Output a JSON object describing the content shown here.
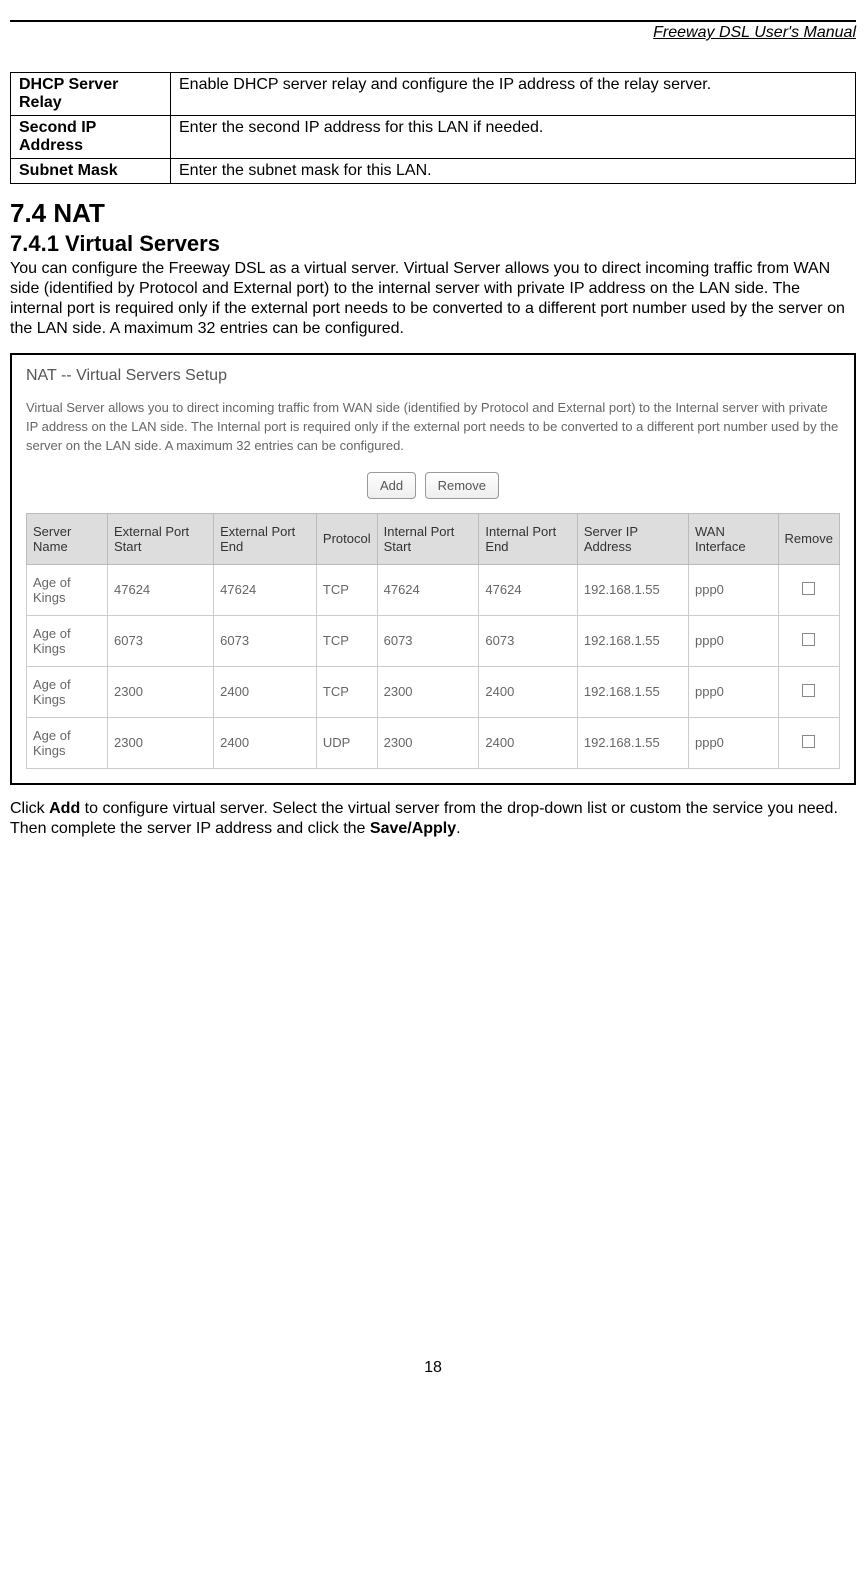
{
  "header": {
    "manual_title": "Freeway DSL User's Manual"
  },
  "def_table": [
    {
      "label": "DHCP Server Relay",
      "desc": "Enable DHCP server relay and configure the IP address of the relay server."
    },
    {
      "label": "Second IP Address",
      "desc": "Enter the second IP address for this LAN if needed."
    },
    {
      "label": "Subnet Mask",
      "desc": "Enter the subnet mask for this LAN."
    }
  ],
  "section": {
    "num_title": "7.4   NAT",
    "sub_num_title": "7.4.1    Virtual Servers",
    "intro": "You can configure the Freeway DSL as a virtual server. Virtual Server allows you to direct incoming traffic from WAN side (identified by Protocol and External port) to the internal server with private IP address on the LAN side. The internal port is required only if the external port needs to be converted to a different port number used by the server on the LAN side. A maximum 32 entries can be configured."
  },
  "screenshot": {
    "title": "NAT -- Virtual Servers Setup",
    "para": "Virtual Server allows you to direct incoming traffic from WAN side (identified by Protocol and External port) to the Internal server with private IP address on the LAN side. The Internal port is required only if the external port needs to be converted to a different port number used by the server on the LAN side. A maximum 32 entries can be configured.",
    "buttons": {
      "add": "Add",
      "remove": "Remove"
    },
    "headers": [
      "Server Name",
      "External Port Start",
      "External Port End",
      "Protocol",
      "Internal Port Start",
      "Internal Port End",
      "Server IP Address",
      "WAN Interface",
      "Remove"
    ],
    "rows": [
      {
        "name": "Age of Kings",
        "eps": "47624",
        "epe": "47624",
        "proto": "TCP",
        "ips": "47624",
        "ipe": "47624",
        "ip": "192.168.1.55",
        "wan": "ppp0"
      },
      {
        "name": "Age of Kings",
        "eps": "6073",
        "epe": "6073",
        "proto": "TCP",
        "ips": "6073",
        "ipe": "6073",
        "ip": "192.168.1.55",
        "wan": "ppp0"
      },
      {
        "name": "Age of Kings",
        "eps": "2300",
        "epe": "2400",
        "proto": "TCP",
        "ips": "2300",
        "ipe": "2400",
        "ip": "192.168.1.55",
        "wan": "ppp0"
      },
      {
        "name": "Age of Kings",
        "eps": "2300",
        "epe": "2400",
        "proto": "UDP",
        "ips": "2300",
        "ipe": "2400",
        "ip": "192.168.1.55",
        "wan": "ppp0"
      }
    ]
  },
  "after": {
    "pre1": "Click ",
    "bold1": "Add",
    "mid1": " to configure virtual server. Select the virtual server from the drop-down list or custom the service you need. Then complete the server IP address and click the ",
    "bold2": "Save/Apply",
    "post": "."
  },
  "page_number": "18"
}
